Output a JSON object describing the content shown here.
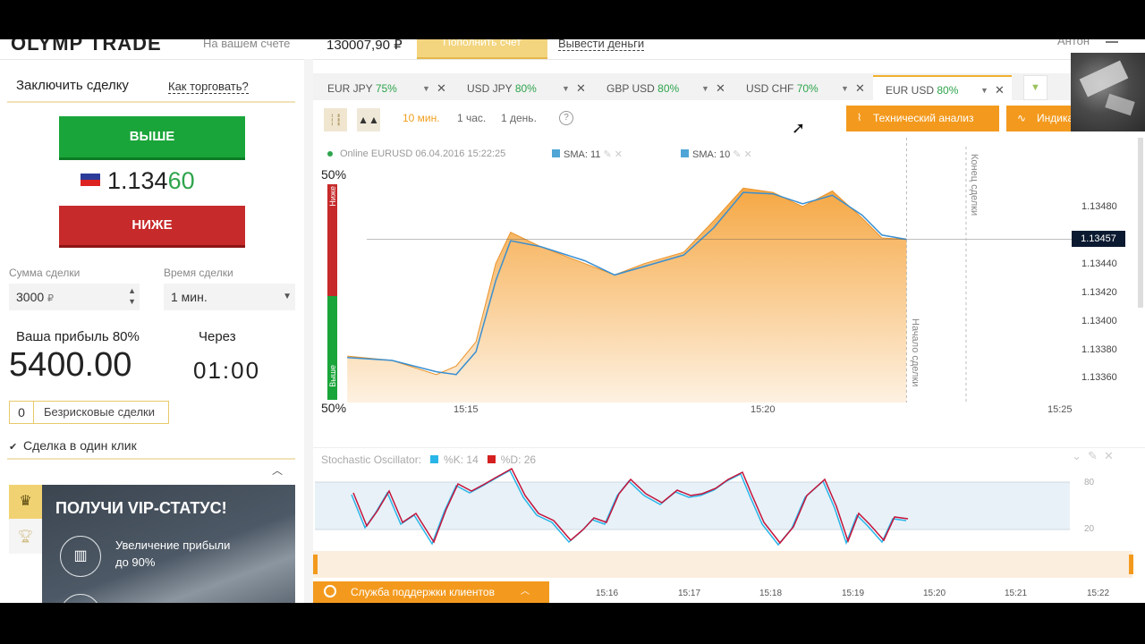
{
  "header": {
    "logo": "OLYMP TRADE",
    "account_label": "На вашем счете",
    "account_value": "130007,90 ₽",
    "deposit_label": "Пополнить счет",
    "withdraw_label": "Вывести деньги",
    "user_name": "Антон"
  },
  "deal": {
    "title": "Заключить сделку",
    "how_to_trade": "Как торговать?",
    "up_label": "ВЫШЕ",
    "down_label": "НИЖЕ",
    "price_main": "1.134",
    "price_tail": "60",
    "amount_label": "Сумма сделки",
    "amount_value": "3000",
    "currency": "₽",
    "time_label": "Время сделки",
    "time_value": "1 мин.",
    "profit_label": "Ваша прибыль 80%",
    "profit_value": "5400.00",
    "through_label": "Через",
    "timer": "01:00",
    "riskfree_count": "0",
    "riskfree_label": "Безрисковые сделки",
    "oneclick_label": "Сделка в один клик"
  },
  "vip": {
    "title": "ПОЛУЧИ VIP-СТАТУС!",
    "benefit": "Увеличение прибыли до 90%"
  },
  "tabs": [
    {
      "pair": "EUR JPY",
      "pct": "75%"
    },
    {
      "pair": "USD JPY",
      "pct": "80%"
    },
    {
      "pair": "GBP USD",
      "pct": "80%"
    },
    {
      "pair": "USD CHF",
      "pct": "70%"
    },
    {
      "pair": "EUR USD",
      "pct": "80%"
    }
  ],
  "toolbar": {
    "tf": [
      "10 мин.",
      "1 час.",
      "1 день."
    ],
    "help": "?",
    "tech_analysis": "Технический анализ",
    "indicators": "Индикаторы"
  },
  "chart": {
    "online": "Online EURUSD 06.04.2016 15:22:25",
    "sma1": "SMA: 11",
    "sma2": "SMA: 10",
    "top_pct": "50%",
    "bottom_pct": "50%",
    "down_word": "Ниже",
    "up_word": "Выше",
    "current_price": "1.13457",
    "end_label": "Конец сделки",
    "start_label": "Начало сделки",
    "colors": {
      "area": "#f5a33a",
      "sma": "#3a8fd0"
    }
  },
  "chart_data": {
    "type": "area",
    "title": "Online EURUSD 06.04.2016 15:22:25",
    "x_ticks": [
      "15:15",
      "15:20",
      "15:25"
    ],
    "y_ticks": [
      1.1336,
      1.1338,
      1.134,
      1.1342,
      1.1344,
      1.1348
    ],
    "ylim": [
      1.1333,
      1.1352
    ],
    "series": [
      {
        "name": "EURUSD",
        "x": [
          "15:13:00",
          "15:13:45",
          "15:14:30",
          "15:14:50",
          "15:15:10",
          "15:15:30",
          "15:15:45",
          "15:16:15",
          "15:17:00",
          "15:17:30",
          "15:18:00",
          "15:18:40",
          "15:19:10",
          "15:19:40",
          "15:20:10",
          "15:20:40",
          "15:21:10",
          "15:21:40",
          "15:22:00",
          "15:22:25"
        ],
        "values": [
          1.13375,
          1.13372,
          1.13362,
          1.13368,
          1.13385,
          1.1344,
          1.13462,
          1.13452,
          1.1344,
          1.13432,
          1.1344,
          1.13448,
          1.1347,
          1.13493,
          1.1349,
          1.1348,
          1.13491,
          1.13472,
          1.13458,
          1.13457
        ]
      },
      {
        "name": "SMA: 11",
        "values": [
          1.13374,
          1.13372,
          1.13364,
          1.13362,
          1.13378,
          1.13428,
          1.13456,
          1.13452,
          1.13442,
          1.13432,
          1.13438,
          1.13446,
          1.13465,
          1.1349,
          1.13489,
          1.13482,
          1.13488,
          1.13474,
          1.1346,
          1.13457
        ]
      }
    ]
  },
  "stochastic": {
    "title": "Stochastic Oscillator:",
    "k": "%K: 14",
    "d": "%D: 26",
    "level_high": "80",
    "level_low": "20"
  },
  "bottom": {
    "support": "Служба поддержки клиентов",
    "times": [
      "15:16",
      "15:17",
      "15:18",
      "15:19",
      "15:20",
      "15:21",
      "15:22"
    ]
  }
}
